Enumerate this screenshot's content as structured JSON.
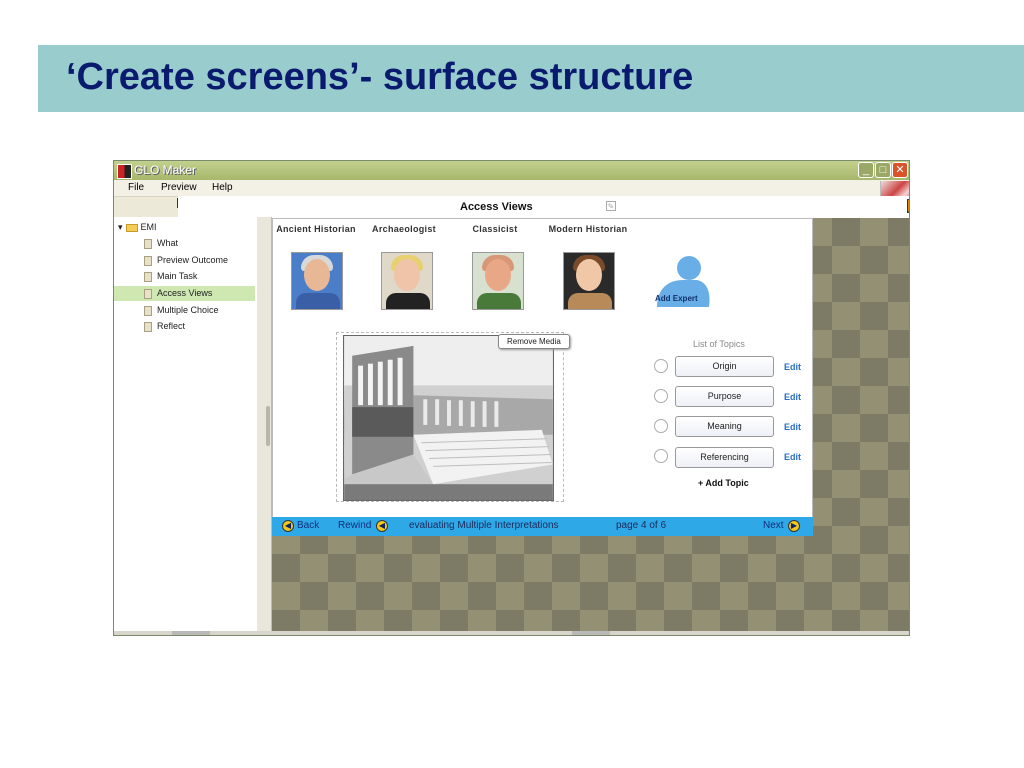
{
  "slide": {
    "title": "‘Create screens’- surface structure"
  },
  "window": {
    "title": "GLO Maker",
    "controls": {
      "minimize": "_",
      "maximize": "□",
      "close": "✕"
    }
  },
  "menu": [
    "File",
    "Preview",
    "Help"
  ],
  "header": {
    "title": "Access Views"
  },
  "tree": {
    "root": "EMI",
    "items": [
      "What",
      "Preview Outcome",
      "Main Task",
      "Access Views",
      "Multiple Choice",
      "Reflect"
    ],
    "selected": "Access Views"
  },
  "experts": [
    {
      "label": "Ancient Historian"
    },
    {
      "label": "Archaeologist"
    },
    {
      "label": "Classicist"
    },
    {
      "label": "Modern Historian"
    }
  ],
  "add_expert": "Add Expert",
  "media": {
    "remove_label": "Remove Media"
  },
  "topics": {
    "title": "List of Topics",
    "items": [
      "Origin",
      "Purpose",
      "Meaning",
      "Referencing"
    ],
    "edit_label": "Edit",
    "add_label": "+ Add Topic"
  },
  "nav": {
    "back": "Back",
    "rewind": "Rewind",
    "title": "evaluating Multiple Interpretations",
    "page": "page 4 of 6",
    "next": "Next"
  },
  "colors": {
    "slide_title_bar": "#99cccc",
    "slide_title_text": "#0a1a6e",
    "nav_bar": "#2fa8e8",
    "selected_row": "#cfe8b2",
    "edit_link": "#2a6fc4"
  }
}
